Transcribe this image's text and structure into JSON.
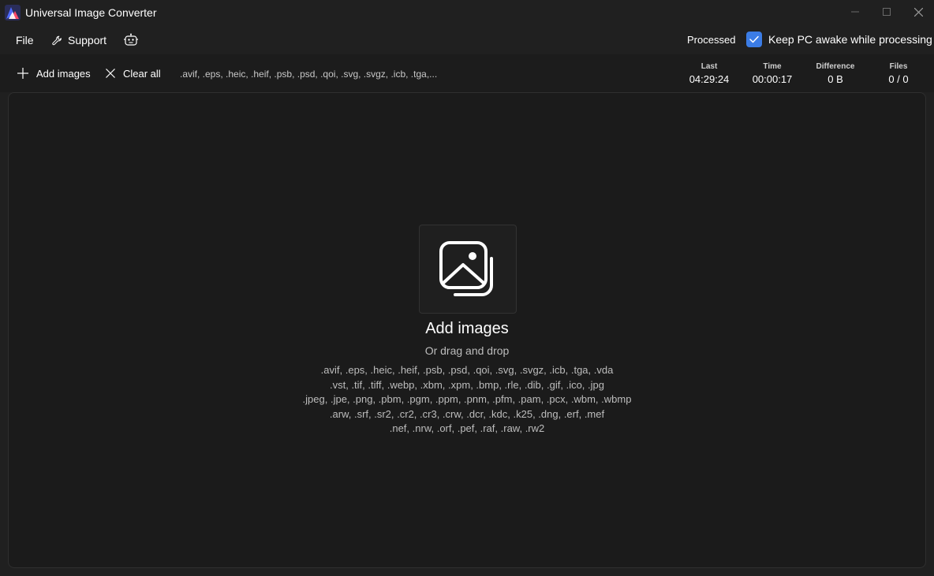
{
  "window": {
    "title": "Universal Image Converter"
  },
  "menu": {
    "file": "File",
    "support": "Support",
    "processed_label": "Processed",
    "keep_awake": {
      "label": "Keep PC awake while processing",
      "checked": true
    }
  },
  "toolbar": {
    "add_images": "Add images",
    "clear_all": "Clear all",
    "formats_summary": ".avif, .eps, .heic, .heif, .psb, .psd, .qoi, .svg, .svgz, .icb, .tga,..."
  },
  "stats": {
    "last": {
      "label": "Last",
      "value": "04:29:24"
    },
    "time": {
      "label": "Time",
      "value": "00:00:17"
    },
    "difference": {
      "label": "Difference",
      "value": "0 B"
    },
    "files": {
      "label": "Files",
      "value": "0 / 0"
    }
  },
  "dropzone": {
    "title": "Add images",
    "subtitle": "Or drag and drop",
    "formats": [
      ".avif, .eps, .heic, .heif, .psb, .psd, .qoi, .svg, .svgz, .icb, .tga, .vda",
      ".vst, .tif, .tiff, .webp, .xbm, .xpm, .bmp, .rle, .dib, .gif, .ico, .jpg",
      ".jpeg, .jpe, .png, .pbm, .pgm, .ppm, .pnm, .pfm, .pam, .pcx, .wbm, .wbmp",
      ".arw, .srf, .sr2, .cr2, .cr3, .crw, .dcr, .kdc, .k25, .dng, .erf, .mef",
      ".nef, .nrw, .orf, .pef, .raf, .raw, .rw2"
    ]
  },
  "colors": {
    "background": "#202020",
    "toolbar": "#1c1c1c",
    "dropzone": "#1b1b1b",
    "accent": "#3b7ce5"
  },
  "icons": {
    "app": "app-logo-icon",
    "support": "wrench-icon",
    "bot": "robot-icon",
    "add": "plus-icon",
    "clear": "close-icon",
    "checkbox": "checkmark-icon",
    "dropzone": "image-stack-icon"
  }
}
